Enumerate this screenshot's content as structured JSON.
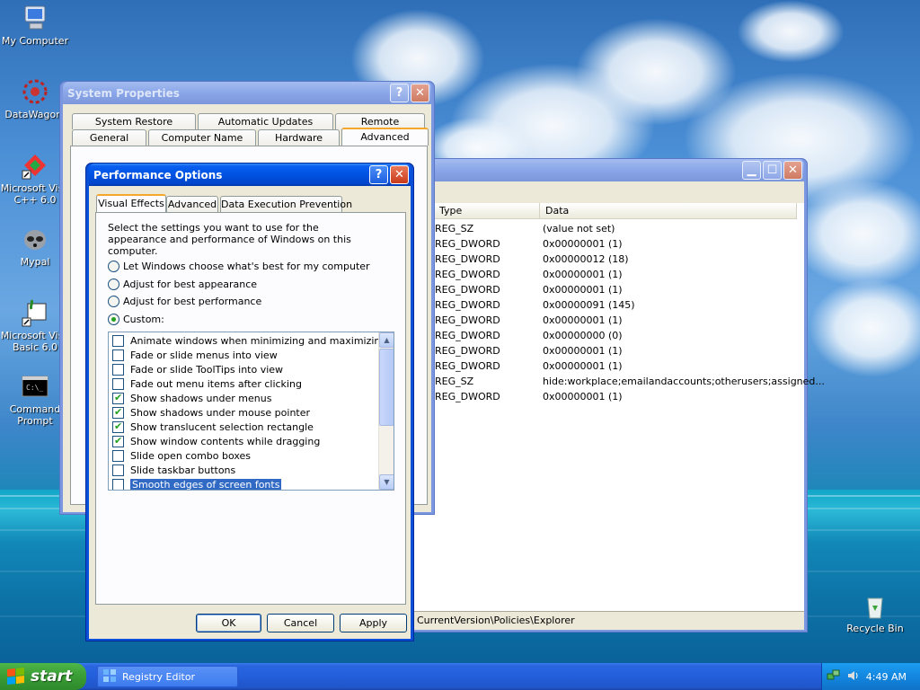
{
  "desktop": {
    "icons": [
      {
        "label": "My Computer"
      },
      {
        "label": "DataWagon."
      },
      {
        "label": "Microsoft Visu C++ 6.0"
      },
      {
        "label": "Mypal"
      },
      {
        "label": "Microsoft Visu Basic 6.0"
      },
      {
        "label": "Command Prompt"
      },
      {
        "label": "Recycle Bin"
      }
    ]
  },
  "system_properties": {
    "title": "System Properties",
    "help_glyph": "?",
    "close_glyph": "✕",
    "tabs_row1": [
      "System Restore",
      "Automatic Updates",
      "Remote"
    ],
    "tabs_row2": [
      "General",
      "Computer Name",
      "Hardware",
      "Advanced"
    ],
    "active_tab": "Advanced"
  },
  "registry_editor": {
    "min_glyph": "▁",
    "max_glyph": "☐",
    "close_glyph": "✕",
    "columns": [
      "Type",
      "Data"
    ],
    "rows": [
      {
        "type": "REG_SZ",
        "data": "(value not set)"
      },
      {
        "type": "REG_DWORD",
        "data": "0x00000001 (1)"
      },
      {
        "type": "REG_DWORD",
        "data": "0x00000012 (18)"
      },
      {
        "type": "REG_DWORD",
        "data": "0x00000001 (1)"
      },
      {
        "type": "REG_DWORD",
        "data": "0x00000001 (1)"
      },
      {
        "type": "REG_DWORD",
        "data": "0x00000091 (145)"
      },
      {
        "type": "REG_DWORD",
        "data": "0x00000001 (1)"
      },
      {
        "type": "REG_DWORD",
        "data": "0x00000000 (0)"
      },
      {
        "type": "REG_DWORD",
        "data": "0x00000001 (1)"
      },
      {
        "type": "REG_DWORD",
        "data": "0x00000001 (1)"
      },
      {
        "type": "REG_SZ",
        "data": "hide:workplace;emailandaccounts;otherusers;assigned..."
      },
      {
        "type": "REG_DWORD",
        "data": "0x00000001 (1)"
      }
    ],
    "status_path": "CurrentVersion\\Policies\\Explorer"
  },
  "performance_options": {
    "title": "Performance Options",
    "help_glyph": "?",
    "close_glyph": "✕",
    "tabs": [
      "Visual Effects",
      "Advanced",
      "Data Execution Prevention"
    ],
    "active_tab": "Visual Effects",
    "description": "Select the settings you want to use for the appearance and performance of Windows on this computer.",
    "radios": [
      {
        "label": "Let Windows choose what's best for my computer",
        "selected": false
      },
      {
        "label": "Adjust for best appearance",
        "selected": false
      },
      {
        "label": "Adjust for best performance",
        "selected": false
      },
      {
        "label": "Custom:",
        "selected": true
      }
    ],
    "checklist": [
      {
        "label": "Animate windows when minimizing and maximizing",
        "checked": false
      },
      {
        "label": "Fade or slide menus into view",
        "checked": false
      },
      {
        "label": "Fade or slide ToolTips into view",
        "checked": false
      },
      {
        "label": "Fade out menu items after clicking",
        "checked": false
      },
      {
        "label": "Show shadows under menus",
        "checked": true
      },
      {
        "label": "Show shadows under mouse pointer",
        "checked": true
      },
      {
        "label": "Show translucent selection rectangle",
        "checked": true
      },
      {
        "label": "Show window contents while dragging",
        "checked": true
      },
      {
        "label": "Slide open combo boxes",
        "checked": false
      },
      {
        "label": "Slide taskbar buttons",
        "checked": false
      },
      {
        "label": "Smooth edges of screen fonts",
        "checked": false,
        "selected": true
      }
    ],
    "buttons": {
      "ok": "OK",
      "cancel": "Cancel",
      "apply": "Apply"
    }
  },
  "taskbar": {
    "start_label": "start",
    "task_button": "Registry Editor",
    "clock": "4:49 AM"
  },
  "colors": {
    "xp_blue": "#0052e2",
    "start_green": "#3a9f36",
    "selection": "#316ac5",
    "check_green": "#21a121"
  }
}
